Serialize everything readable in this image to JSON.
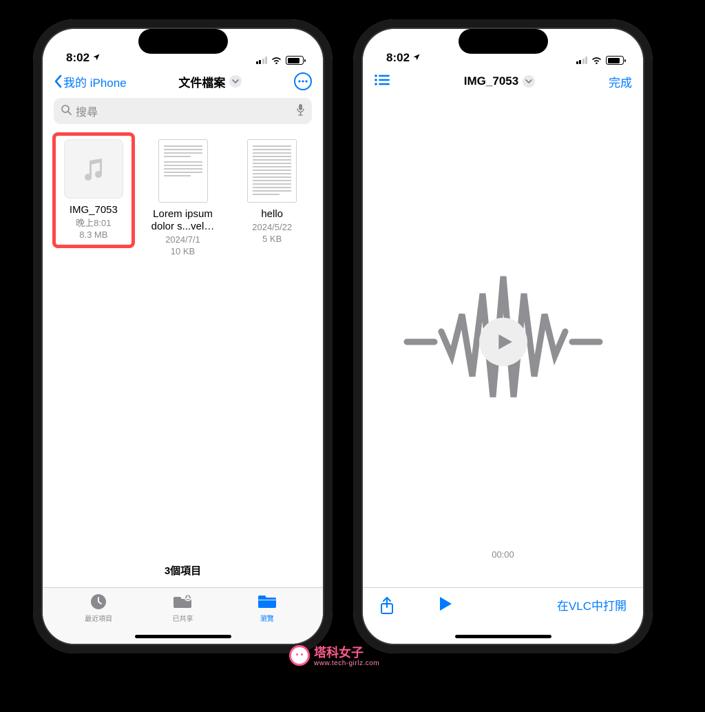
{
  "status": {
    "time": "8:02",
    "location_icon": "◤"
  },
  "left": {
    "nav": {
      "back_label": "我的 iPhone",
      "title": "文件檔案"
    },
    "search": {
      "placeholder": "搜尋"
    },
    "files": [
      {
        "name": "IMG_7053",
        "date": "晚上8:01",
        "size": "8.3 MB",
        "kind": "audio",
        "highlighted": true
      },
      {
        "name": "Lorem ipsum dolor s...vel…",
        "date": "2024/7/1",
        "size": "10 KB",
        "kind": "doc"
      },
      {
        "name": "hello",
        "date": "2024/5/22",
        "size": "5 KB",
        "kind": "doc"
      }
    ],
    "summary": "3個項目",
    "tabs": {
      "recent": "最近項目",
      "shared": "已共享",
      "browse": "瀏覽"
    }
  },
  "right": {
    "nav": {
      "title": "IMG_7053",
      "done": "完成"
    },
    "timecode": "00:00",
    "open_in": "在VLC中打開"
  },
  "watermark": {
    "title": "塔科女子",
    "subtitle": "www.tech-girlz.com"
  },
  "colors": {
    "accent": "#007aff",
    "highlight": "#ff4747",
    "brand": "#ff5a8c"
  }
}
